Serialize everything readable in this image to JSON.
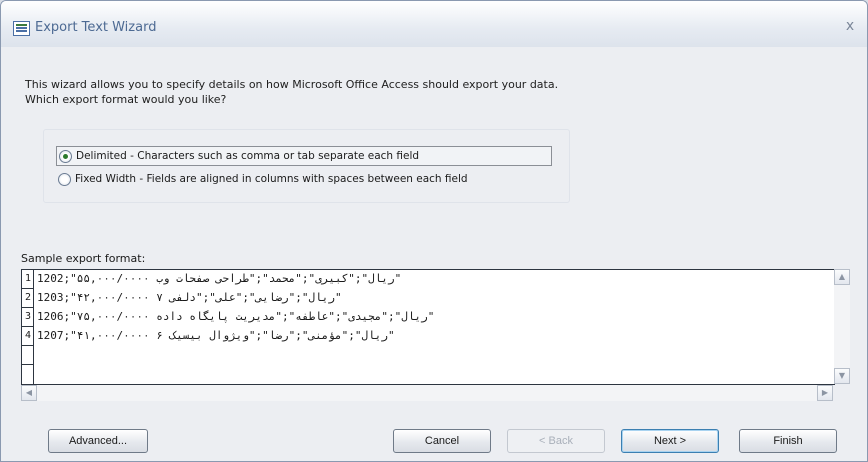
{
  "window": {
    "title": "Export Text Wizard",
    "close_glyph": "x"
  },
  "intro": "This wizard allows you to specify details on how Microsoft Office Access should export your data. Which export format would you like?",
  "format_options": [
    {
      "label": "Delimited - Characters such as comma or tab separate each field",
      "selected": true
    },
    {
      "label": "Fixed Width - Fields are aligned in columns with spaces between each field",
      "selected": false
    }
  ],
  "sample": {
    "label": "Sample export format:",
    "rows": [
      {
        "num": "1",
        "text": "1202;\"۵۵,۰۰۰/۰۰۰۰ ریال\";\"کبیری\";\"محمد\";\"طراحی صفحات وب\""
      },
      {
        "num": "2",
        "text": "1203;\"۴۲,۰۰۰/۰۰۰۰ ریال\";\"رضایی\";\"علی\";\"دلفی ۷\""
      },
      {
        "num": "3",
        "text": "1206;\"۷۵,۰۰۰/۰۰۰۰ ریال\";\"مجیدی\";\"عاطفه\";\"مدیریت پایگاه داده\""
      },
      {
        "num": "4",
        "text": "1207;\"۴۱,۰۰۰/۰۰۰۰ ریال\";\"مؤمنی\";\"رضا\";\"ویژوال بیسیک ۶\""
      }
    ]
  },
  "buttons": {
    "advanced": "Advanced...",
    "cancel": "Cancel",
    "back": "< Back",
    "next": "Next >",
    "finish": "Finish"
  },
  "icons": {
    "app": "table-export-icon",
    "close": "close-icon",
    "scroll_up": "arrow-up-icon",
    "scroll_down": "arrow-down-icon",
    "scroll_left": "arrow-left-icon",
    "scroll_right": "arrow-right-icon"
  }
}
